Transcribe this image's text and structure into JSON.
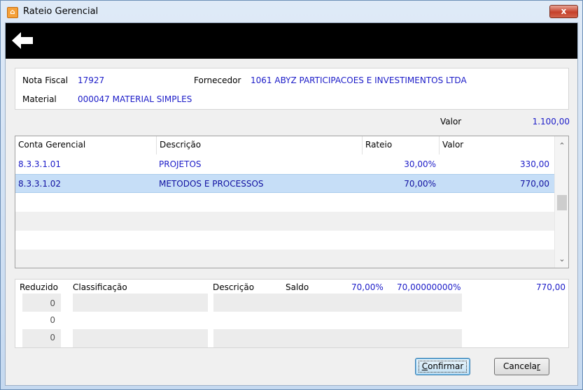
{
  "window": {
    "title": "Rateio Gerencial",
    "close": "x"
  },
  "info": {
    "nota_fiscal_label": "Nota Fiscal",
    "nota_fiscal_value": "17927",
    "fornecedor_label": "Fornecedor",
    "fornecedor_value": "1061 ABYZ PARTICIPACOES E INVESTIMENTOS LTDA",
    "material_label": "Material",
    "material_value": "000047 MATERIAL SIMPLES"
  },
  "valor": {
    "label": "Valor",
    "value": "1.100,00"
  },
  "grid": {
    "columns": [
      "Conta Gerencial",
      "Descrição",
      "Rateio",
      "Valor"
    ],
    "rows": [
      {
        "conta": "8.3.3.1.01",
        "descricao": "PROJETOS",
        "rateio": "30,00%",
        "valor": "330,00",
        "selected": false
      },
      {
        "conta": "8.3.3.1.02",
        "descricao": "METODOS E PROCESSOS",
        "rateio": "70,00%",
        "valor": "770,00",
        "selected": true
      }
    ]
  },
  "bottom": {
    "reduzido_label": "Reduzido",
    "classificacao_label": "Classificação",
    "descricao_label": "Descrição",
    "saldo_label": "Saldo",
    "pct1": "70,00%",
    "pct2": "70,00000000%",
    "total": "770,00",
    "reduzido_values": [
      "0",
      "0",
      "0"
    ]
  },
  "buttons": {
    "confirmar_first": "C",
    "confirmar_rest": "onfirmar",
    "cancelar_main": "Cancela",
    "cancelar_last": "r"
  }
}
